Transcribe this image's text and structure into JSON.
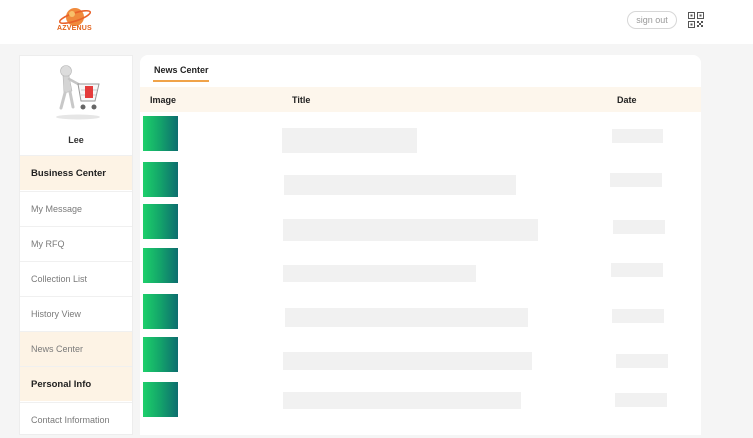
{
  "header": {
    "logo_text": "AZVENUS",
    "signout_label": "sign out",
    "qr_icon": "qr-code-icon"
  },
  "sidebar": {
    "user_name": "Lee",
    "items": [
      {
        "label": "Business Center",
        "type": "section"
      },
      {
        "label": "My Message",
        "type": "link"
      },
      {
        "label": "My RFQ",
        "type": "link"
      },
      {
        "label": "Collection List",
        "type": "link"
      },
      {
        "label": "History View",
        "type": "link"
      },
      {
        "label": "News Center",
        "type": "link",
        "active": true
      },
      {
        "label": "Personal Info",
        "type": "section"
      },
      {
        "label": "Contact Information",
        "type": "link"
      }
    ]
  },
  "main": {
    "tab_label": "News Center",
    "columns": [
      "Image",
      "Title",
      "Date"
    ],
    "rows": [
      {
        "title": "",
        "date": ""
      },
      {
        "title": "",
        "date": ""
      },
      {
        "title": "",
        "date": ""
      },
      {
        "title": "",
        "date": ""
      },
      {
        "title": "",
        "date": ""
      },
      {
        "title": "",
        "date": ""
      },
      {
        "title": "",
        "date": ""
      }
    ]
  },
  "colors": {
    "accent": "#f0a34a",
    "section_bg": "#fdf3e5",
    "thumb_green": "#1ed06b",
    "thumb_teal": "#0d6d6f"
  }
}
